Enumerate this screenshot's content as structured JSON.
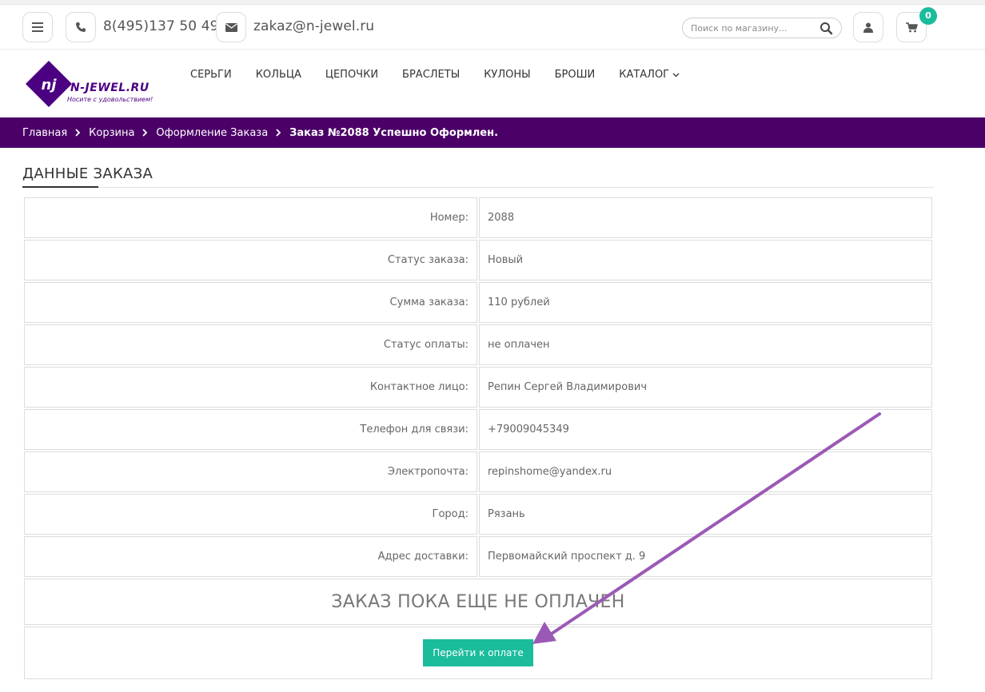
{
  "topbar": {
    "phone": "8(495)137 50 49",
    "email": "zakaz@n-jewel.ru",
    "search_placeholder": "Поиск по магазину...",
    "cart_count": "0",
    "icons": [
      "menu-icon",
      "phone-icon",
      "envelope-icon",
      "search-icon",
      "user-icon",
      "cart-icon"
    ]
  },
  "logo": {
    "mark": "nj",
    "name": "N-JEWEL.RU",
    "tagline": "Носите с удовольствием!"
  },
  "nav": {
    "items": [
      "СЕРЬГИ",
      "КОЛЬЦА",
      "ЦЕПОЧКИ",
      "БРАСЛЕТЫ",
      "КУЛОНЫ",
      "БРОШИ"
    ],
    "catalog": "КАТАЛОГ"
  },
  "breadcrumb": {
    "items": [
      "Главная",
      "Корзина",
      "Оформление Заказа"
    ],
    "current": "Заказ №2088 Успешно Оформлен."
  },
  "order": {
    "title": "ДАННЫЕ ЗАКАЗА",
    "rows": [
      {
        "label": "Номер:",
        "value": "2088"
      },
      {
        "label": "Статус заказа:",
        "value": "Новый"
      },
      {
        "label": "Сумма заказа:",
        "value": "110 рублей"
      },
      {
        "label": "Статус оплаты:",
        "value": "не оплачен"
      },
      {
        "label": "Контактное лицо:",
        "value": "Репин Сергей Владимирович"
      },
      {
        "label": "Телефон для связи:",
        "value": "+79009045349"
      },
      {
        "label": "Электропочта:",
        "value": "repinshome@yandex.ru"
      },
      {
        "label": "Город:",
        "value": "Рязань"
      },
      {
        "label": "Адрес доставки:",
        "value": "Первомайский проспект д. 9"
      }
    ],
    "notice": "ЗАКАЗ ПОКА ЕЩЕ НЕ ОПЛАЧЕН",
    "pay_button": "Перейти к оплате"
  },
  "colors": {
    "brand_purple": "#4b0068",
    "accent_green": "#1abc9c",
    "annotation_arrow": "#9b59b6"
  }
}
